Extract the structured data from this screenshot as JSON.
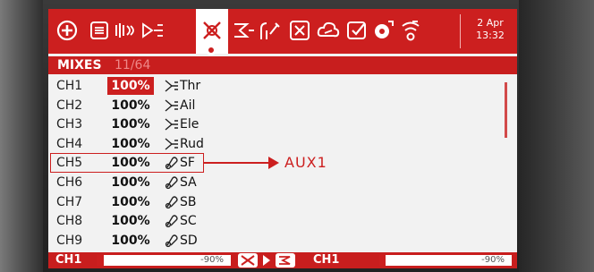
{
  "topbar": {
    "tabs": [
      {
        "icon": "home-icon"
      },
      {
        "icon": "model-list-icon"
      },
      {
        "icon": "model-setup-icon"
      },
      {
        "icon": "inputs-icon"
      },
      {
        "icon": "mixes-icon",
        "active": true
      },
      {
        "icon": "outputs-icon"
      },
      {
        "icon": "curves-icon"
      },
      {
        "icon": "logical-switches-icon"
      },
      {
        "icon": "special-functions-icon"
      },
      {
        "icon": "custom-scripts-icon"
      },
      {
        "icon": "telemetry-icon"
      },
      {
        "icon": "radio-setup-icon"
      }
    ],
    "date": "2 Apr",
    "time": "13:32"
  },
  "title": {
    "label": "MIXES",
    "count": "11/64"
  },
  "mixes": [
    {
      "channel": "CH1",
      "weight": "100%",
      "source": "Thr",
      "source_icon": "stick-icon",
      "selected": true
    },
    {
      "channel": "CH2",
      "weight": "100%",
      "source": "Ail",
      "source_icon": "stick-icon"
    },
    {
      "channel": "CH3",
      "weight": "100%",
      "source": "Ele",
      "source_icon": "stick-icon"
    },
    {
      "channel": "CH4",
      "weight": "100%",
      "source": "Rud",
      "source_icon": "stick-icon"
    },
    {
      "channel": "CH5",
      "weight": "100%",
      "source": "SF",
      "source_icon": "switch-icon"
    },
    {
      "channel": "CH6",
      "weight": "100%",
      "source": "SA",
      "source_icon": "switch-icon"
    },
    {
      "channel": "CH7",
      "weight": "100%",
      "source": "SB",
      "source_icon": "switch-icon"
    },
    {
      "channel": "CH8",
      "weight": "100%",
      "source": "SC",
      "source_icon": "switch-icon"
    },
    {
      "channel": "CH9",
      "weight": "100%",
      "source": "SD",
      "source_icon": "switch-icon"
    }
  ],
  "annotation": {
    "label": "AUX1",
    "color": "#cc1f1f"
  },
  "bottombar": {
    "left_channel": "CH1",
    "left_value": "-90%",
    "left_fill_fraction": 0.05,
    "right_channel": "CH1",
    "right_value": "-90%",
    "right_fill_fraction": 0.05
  },
  "colors": {
    "accent": "#cc1f1f",
    "screen_bg": "#f2f2f2"
  }
}
